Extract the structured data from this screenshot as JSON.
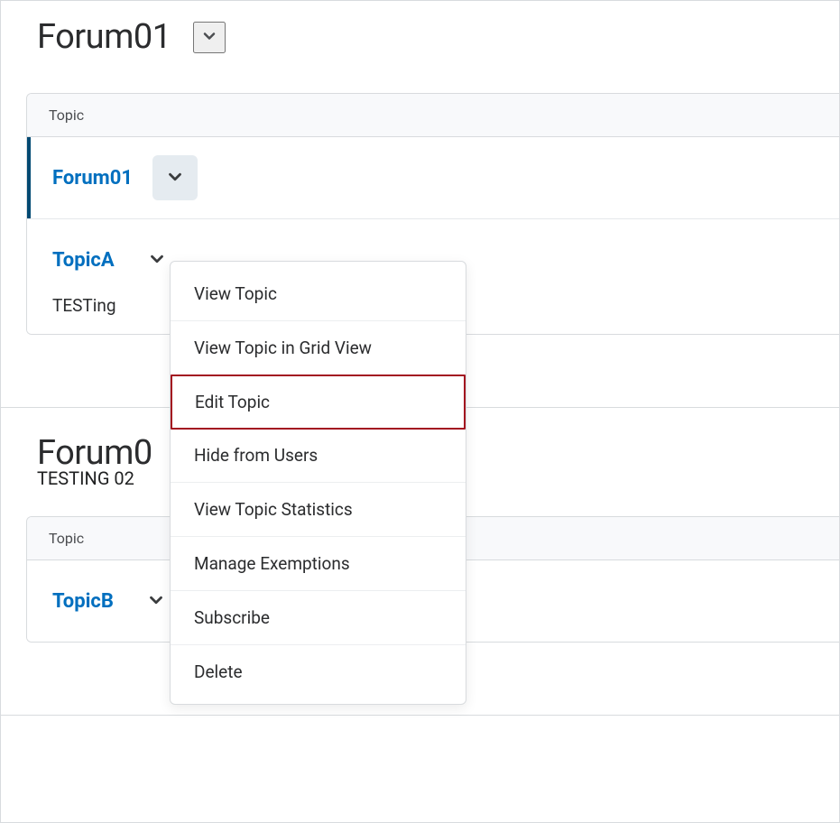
{
  "forums": [
    {
      "title": "Forum01",
      "tableHeader": "Topic",
      "topics": [
        {
          "name": "Forum01",
          "description": "",
          "active": true,
          "dropdownOpen": true
        },
        {
          "name": "TopicA",
          "description": "TESTing",
          "active": false,
          "dropdownOpen": false
        }
      ]
    },
    {
      "title": "Forum0",
      "description": "TESTING 02",
      "tableHeader": "Topic",
      "topics": [
        {
          "name": "TopicB",
          "description": "",
          "active": false,
          "dropdownOpen": false
        }
      ]
    }
  ],
  "dropdown": {
    "items": [
      {
        "label": "View Topic",
        "highlighted": false
      },
      {
        "label": "View Topic in Grid View",
        "highlighted": false
      },
      {
        "label": "Edit Topic",
        "highlighted": true
      },
      {
        "label": "Hide from Users",
        "highlighted": false
      },
      {
        "label": "View Topic Statistics",
        "highlighted": false
      },
      {
        "label": "Manage Exemptions",
        "highlighted": false
      },
      {
        "label": "Subscribe",
        "highlighted": false
      },
      {
        "label": "Delete",
        "highlighted": false
      }
    ]
  }
}
